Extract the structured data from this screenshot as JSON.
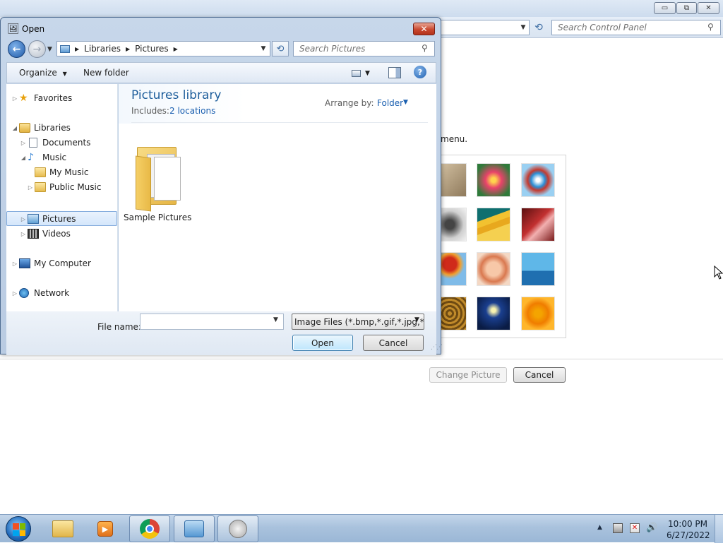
{
  "background_window": {
    "search_placeholder": "Search Control Panel",
    "menu_text": "menu.",
    "change_picture_label": "Change Picture",
    "cancel_label": "Cancel",
    "caption_buttons": {
      "minimize": "▭",
      "restore": "⧉",
      "close": "✕"
    }
  },
  "dialog": {
    "title": "Open",
    "close_glyph": "✕",
    "breadcrumb": [
      "Libraries",
      "Pictures"
    ],
    "search_placeholder": "Search Pictures",
    "toolbar": {
      "organize_label": "Organize",
      "new_folder_label": "New folder"
    },
    "nav": {
      "favorites": "Favorites",
      "libraries": "Libraries",
      "documents": "Documents",
      "music": "Music",
      "my_music": "My Music",
      "public_music": "Public Music",
      "pictures": "Pictures",
      "videos": "Videos",
      "my_computer": "My Computer",
      "network": "Network"
    },
    "library": {
      "title": "Pictures library",
      "includes_label": "Includes:",
      "locations_link": "2 locations",
      "arrange_label": "Arrange by:",
      "arrange_value": "Folder"
    },
    "items": [
      {
        "name": "Sample Pictures",
        "type": "folder"
      }
    ],
    "footer": {
      "file_name_label": "File name:",
      "file_name_value": "",
      "file_type_value": "Image Files (*.bmp,*.gif,*.jpg,*.",
      "open_label": "Open",
      "cancel_label": "Cancel"
    }
  },
  "taskbar": {
    "clock_time": "10:00 PM",
    "clock_date": "6/27/2022"
  },
  "colors": {
    "library_title": "#1d5d9b",
    "link": "#1a5fb0",
    "close_button": "#c9482f"
  }
}
